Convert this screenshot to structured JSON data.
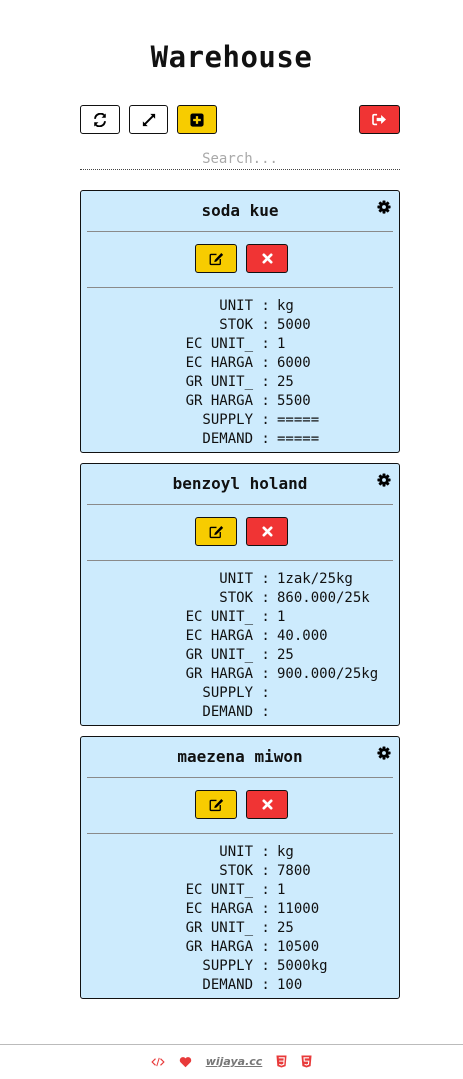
{
  "header": {
    "title": "Warehouse"
  },
  "toolbar": {
    "buttons": [
      {
        "icon": "refresh-icon",
        "color": "#ffffff"
      },
      {
        "icon": "expand-icon",
        "color": "#ffffff"
      },
      {
        "icon": "plus-square-icon",
        "color": "#f7cc00"
      },
      {
        "icon": "sign-out-icon",
        "color": "#f03434"
      }
    ]
  },
  "search": {
    "value": "",
    "placeholder": "Search..."
  },
  "items": [
    {
      "name": "soda kue",
      "fields": [
        {
          "label": "UNIT",
          "value": "kg"
        },
        {
          "label": "STOK",
          "value": "5000"
        },
        {
          "label": "EC UNIT_",
          "value": "1"
        },
        {
          "label": "EC HARGA",
          "value": "6000"
        },
        {
          "label": "GR UNIT_",
          "value": "25"
        },
        {
          "label": "GR HARGA",
          "value": "5500"
        },
        {
          "label": "SUPPLY",
          "value": "====="
        },
        {
          "label": "DEMAND",
          "value": "====="
        }
      ]
    },
    {
      "name": "benzoyl holand",
      "fields": [
        {
          "label": "UNIT",
          "value": "1zak/25kg"
        },
        {
          "label": "STOK",
          "value": "860.000/25k"
        },
        {
          "label": "EC UNIT_",
          "value": "1"
        },
        {
          "label": "EC HARGA",
          "value": "40.000"
        },
        {
          "label": "GR UNIT_",
          "value": "25"
        },
        {
          "label": "GR HARGA",
          "value": "900.000/25kg"
        },
        {
          "label": "SUPPLY",
          "value": ""
        },
        {
          "label": "DEMAND",
          "value": ""
        }
      ]
    },
    {
      "name": "maezena miwon",
      "fields": [
        {
          "label": "UNIT",
          "value": "kg"
        },
        {
          "label": "STOK",
          "value": "7800"
        },
        {
          "label": "EC UNIT_",
          "value": "1"
        },
        {
          "label": "EC HARGA",
          "value": "11000"
        },
        {
          "label": "GR UNIT_",
          "value": "25"
        },
        {
          "label": "GR HARGA",
          "value": "10500"
        },
        {
          "label": "SUPPLY",
          "value": "5000kg"
        },
        {
          "label": "DEMAND",
          "value": "100"
        }
      ]
    }
  ],
  "footer": {
    "link": "wijaya.cc",
    "icons": [
      "code-icon",
      "heart-icon",
      "css3-icon",
      "html5-icon"
    ],
    "accent": "#e83a3a"
  }
}
